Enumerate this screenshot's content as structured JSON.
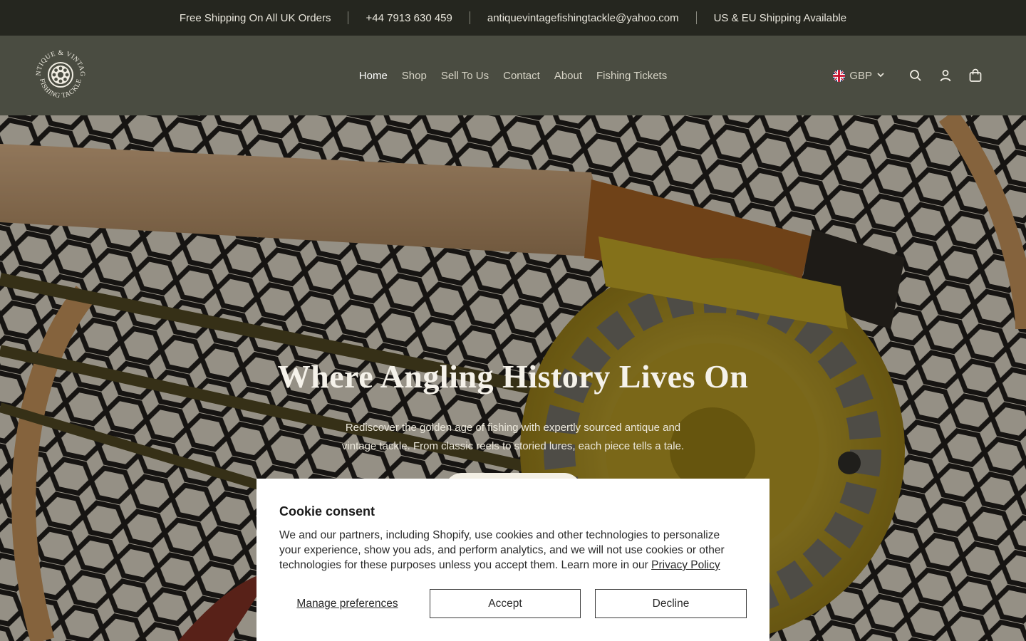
{
  "announcement": {
    "items": [
      "Free Shipping On All UK Orders",
      "+44 7913 630 459",
      "antiquevintagefishingtackle@yahoo.com",
      "US & EU Shipping Available"
    ]
  },
  "header": {
    "logo_text": [
      "ANTIQUE & VINTAGE",
      "FISHING TACKLE"
    ],
    "nav": [
      {
        "label": "Home",
        "active": true
      },
      {
        "label": "Shop",
        "active": false
      },
      {
        "label": "Sell To Us",
        "active": false
      },
      {
        "label": "Contact",
        "active": false
      },
      {
        "label": "About",
        "active": false
      },
      {
        "label": "Fishing Tickets",
        "active": false
      }
    ],
    "currency": "GBP",
    "icons": [
      "chevron-down-icon",
      "search-icon",
      "account-icon",
      "cart-icon"
    ]
  },
  "hero": {
    "title": "Where Angling History Lives On",
    "subtitle_line1": "Rediscover the golden age of fishing with expertly sourced antique and",
    "subtitle_line2": "vintage tackle. From classic reels to storied lures, each piece tells a tale."
  },
  "cookie": {
    "title": "Cookie consent",
    "body": "We and our partners, including Shopify, use cookies and other technologies to personalize your experience, show you ads, and perform analytics, and we will not use cookies or other technologies for these purposes unless you accept them. Learn more in our ",
    "policy_link": "Privacy Policy",
    "manage": "Manage preferences",
    "accept": "Accept",
    "decline": "Decline"
  },
  "colors": {
    "announcement_bg": "#25261f",
    "header_bg": "#4a4c41",
    "reel_gold": "#b59a22"
  }
}
